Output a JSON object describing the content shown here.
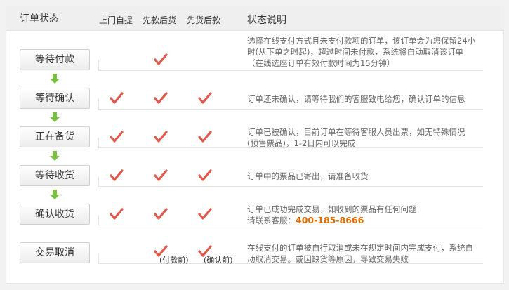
{
  "header": {
    "title": "订单状态",
    "col_pickup": "上门自提",
    "col_prepay": "先款后货",
    "col_cod": "先货后款",
    "col_desc": "状态说明"
  },
  "statuses": [
    {
      "label": "等待付款",
      "pickup": false,
      "prepay": true,
      "cod": false,
      "desc": [
        "选择在线支付方式且未支付款项的订单，该订单会为您保留24小",
        "时(从下单之时起)，超过时间未付款，系统将自动取消该订单",
        "（在线选座订单有效付款时间为15分钟）"
      ]
    },
    {
      "label": "等待确认",
      "pickup": true,
      "prepay": true,
      "cod": true,
      "desc": [
        "订单还未确认，请等待我们的客服致电给您，确认订单的信息"
      ]
    },
    {
      "label": "正在备货",
      "pickup": true,
      "prepay": true,
      "cod": true,
      "desc": [
        "订单已被确认，目前订单在等待客服人员出票，如无特殊情况",
        "(预售票品)，1-2日内可以完成"
      ]
    },
    {
      "label": "等待收货",
      "pickup": true,
      "prepay": true,
      "cod": true,
      "desc": [
        "订单中的票品已寄出，请准备收货"
      ]
    },
    {
      "label": "确认收货",
      "pickup": true,
      "prepay": true,
      "cod": true,
      "desc": [
        "订单已成功完成交易，如收到的票品有任何问题"
      ],
      "contact_prefix": "请联系客服：",
      "hotline": "400-185-8666"
    },
    {
      "label": "交易取消",
      "pickup": false,
      "prepay": true,
      "cod": true,
      "prepay_note": "(付款前)",
      "cod_note": "(确认前)",
      "desc": [
        "在线支付的订单被自行取消或未在规定时间内完成支付，系统自",
        "动取消交易。或因缺货等原因，导致交易失败"
      ]
    }
  ],
  "colors": {
    "check": "#e2574c",
    "arrow": "#7ac143",
    "hotline": "#e06c00"
  },
  "icons": {
    "check": "check-icon",
    "arrow": "arrow-down-icon"
  }
}
